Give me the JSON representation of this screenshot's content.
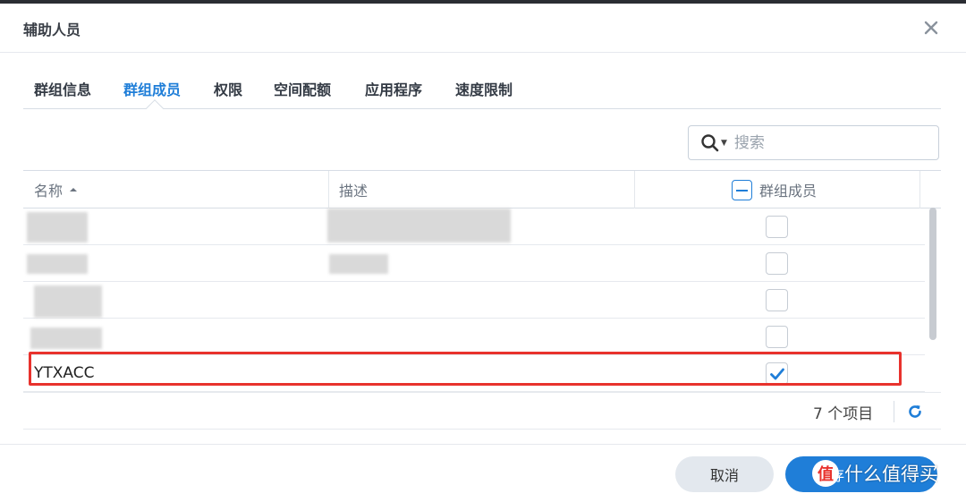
{
  "dialog": {
    "title": "辅助人员",
    "close_icon": "close-icon"
  },
  "tabs": [
    {
      "label": "群组信息",
      "active": false
    },
    {
      "label": "群组成员",
      "active": true
    },
    {
      "label": "权限",
      "active": false
    },
    {
      "label": "空间配额",
      "active": false
    },
    {
      "label": "应用程序",
      "active": false
    },
    {
      "label": "速度限制",
      "active": false
    }
  ],
  "search": {
    "placeholder": "搜索",
    "value": "",
    "icon": "search-icon"
  },
  "grid": {
    "columns": {
      "name": "名称",
      "description": "描述",
      "member": "群组成员"
    },
    "sort": {
      "column": "name",
      "direction": "asc"
    },
    "rows": [
      {
        "name": "",
        "description": "",
        "checked": false,
        "redacted": true
      },
      {
        "name": "",
        "description": "",
        "checked": false,
        "redacted": true
      },
      {
        "name": "",
        "description": "",
        "checked": false,
        "redacted": true
      },
      {
        "name": "",
        "description": "",
        "checked": false,
        "redacted": true
      },
      {
        "name": "YTXACC",
        "description": "",
        "checked": true,
        "redacted": false
      }
    ]
  },
  "footer": {
    "item_count": "7 个项目",
    "refresh_icon": "refresh-icon"
  },
  "buttons": {
    "cancel": "取消",
    "save": "保存"
  },
  "watermark": {
    "logo": "值",
    "text": "什么值得买"
  },
  "colors": {
    "accent": "#1f7ed8",
    "highlight": "#e8322d",
    "cancel_bg": "#e3e8ee"
  }
}
